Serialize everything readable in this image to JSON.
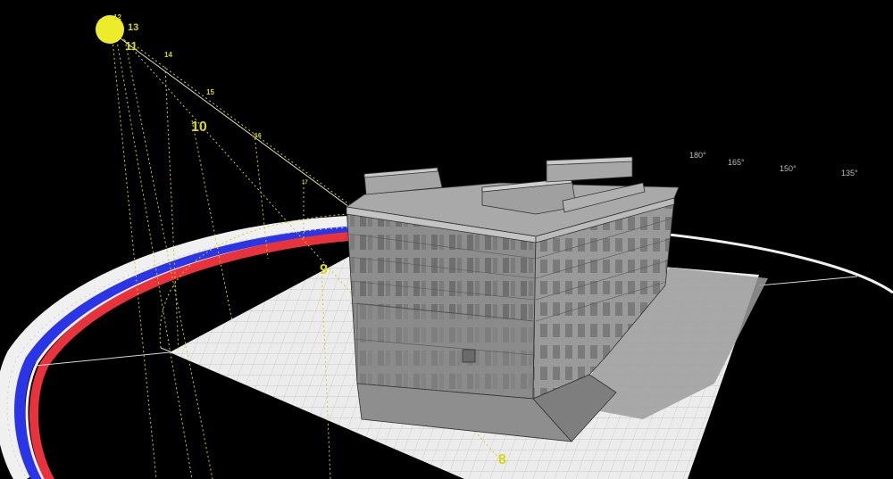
{
  "scene": {
    "background": "#000000",
    "sun_color": "#ecec2a",
    "path_color": "#d6d61a",
    "ground_color": "#eeeeee",
    "building_color": "#8c8c8c"
  },
  "sun_path": {
    "hour_labels": [
      {
        "id": "h12",
        "text": "12"
      },
      {
        "id": "h13",
        "text": "13"
      },
      {
        "id": "h11",
        "text": "11"
      },
      {
        "id": "h14",
        "text": "14"
      },
      {
        "id": "h15",
        "text": "15"
      },
      {
        "id": "h10",
        "text": "10"
      },
      {
        "id": "h16",
        "text": "16"
      },
      {
        "id": "h17",
        "text": "17"
      },
      {
        "id": "h9",
        "text": "9"
      },
      {
        "id": "h8",
        "text": "8"
      }
    ]
  },
  "compass": {
    "azimuth_labels": [
      "180°",
      "165°",
      "150°",
      "135°"
    ],
    "ring_colors": [
      "#f0f0f0",
      "#2b35e8",
      "#f0f0f0",
      "#e8323c",
      "#f0f0f0"
    ]
  }
}
